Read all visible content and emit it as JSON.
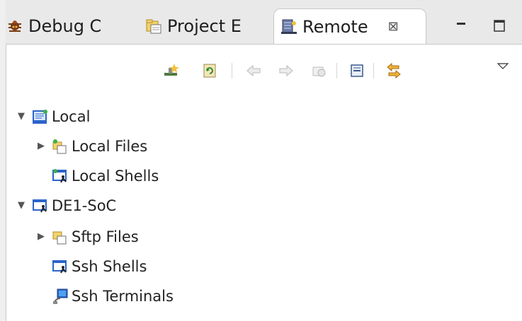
{
  "tabs": [
    {
      "label": "Debug C",
      "icon": "debug-icon"
    },
    {
      "label": "Project E",
      "icon": "project-explorer-icon"
    },
    {
      "label": "Remote",
      "icon": "remote-systems-icon",
      "active": true
    }
  ],
  "tab_close_glyph": "⊠",
  "window_controls": {
    "minimize": "minimize-icon",
    "maximize": "maximize-icon"
  },
  "toolbar": {
    "items": [
      "new-connection-icon",
      "refresh-icon",
      "back-icon",
      "forward-icon",
      "home-icon",
      "collapse-all-icon",
      "link-with-editor-icon",
      "view-menu-icon"
    ]
  },
  "tree": {
    "items": [
      {
        "label": "Local",
        "expanded": true,
        "icon": "local-host-icon"
      },
      {
        "label": "Local Files",
        "expanded": false,
        "icon": "files-icon"
      },
      {
        "label": "Local Shells",
        "icon": "shells-icon"
      },
      {
        "label": "DE1-SoC",
        "expanded": true,
        "icon": "remote-host-icon"
      },
      {
        "label": "Sftp Files",
        "expanded": false,
        "icon": "sftp-files-icon"
      },
      {
        "label": "Ssh Shells",
        "icon": "shells-icon"
      },
      {
        "label": "Ssh Terminals",
        "icon": "terminal-icon"
      }
    ]
  },
  "colors": {
    "accent_blue": "#2b64c9",
    "folder_yellow": "#e6c04a",
    "tab_bg": "#e9e9e9",
    "panel_bg": "#ffffff"
  }
}
